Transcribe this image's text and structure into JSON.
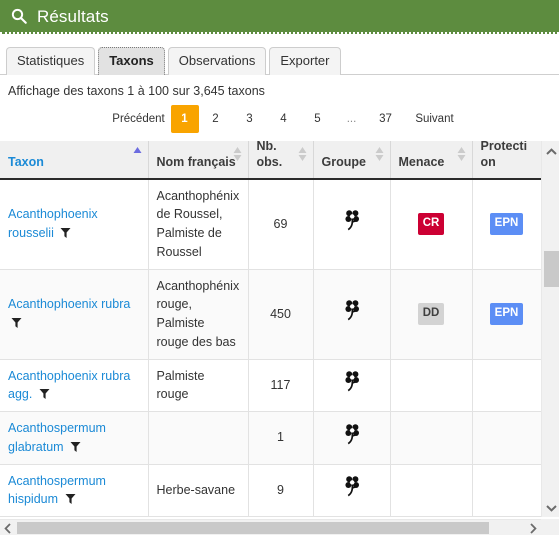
{
  "header": {
    "title": "Résultats",
    "icon": "search-icon",
    "bg_color": "#5d8c3f"
  },
  "tabs": [
    {
      "label": "Statistiques",
      "active": false
    },
    {
      "label": "Taxons",
      "active": true
    },
    {
      "label": "Observations",
      "active": false
    },
    {
      "label": "Exporter",
      "active": false
    }
  ],
  "results": {
    "summary": "Affichage des taxons 1 à 100 sur 3,645 taxons",
    "range_start": 1,
    "range_end": 100,
    "total": "3,645"
  },
  "pagination": {
    "previous_label": "Précédent",
    "next_label": "Suivant",
    "ellipsis": "...",
    "current_page": "1",
    "pages": [
      "1",
      "2",
      "3",
      "4",
      "5",
      "...",
      "37"
    ],
    "active_color": "#f9a400"
  },
  "table": {
    "columns": [
      {
        "label": "Taxon",
        "sorted": true,
        "sort_dir": "asc"
      },
      {
        "label": "Nom français",
        "sorted": false,
        "sort_dir": "none"
      },
      {
        "label": "Nb. obs.",
        "sorted": false,
        "sort_dir": "none"
      },
      {
        "label": "Groupe",
        "sorted": false,
        "sort_dir": "none"
      },
      {
        "label": "Menace",
        "sorted": false,
        "sort_dir": "none"
      },
      {
        "label": "Protection",
        "sorted": false,
        "sort_dir": "none"
      }
    ],
    "rows": [
      {
        "taxon": "Acanthophoenix rousselii",
        "filter_icon": "funnel-icon",
        "nom_francais": "Acanthophénix de Roussel, Palmiste de Roussel",
        "nb_obs": "69",
        "groupe": "flower-icon",
        "menace": "CR",
        "menace_style": "cr",
        "protection": "EPN",
        "protection_style": "epn"
      },
      {
        "taxon": "Acanthophoenix rubra",
        "filter_icon": "funnel-icon",
        "nom_francais": "Acanthophénix rouge, Palmiste rouge des bas",
        "nb_obs": "450",
        "groupe": "flower-icon",
        "menace": "DD",
        "menace_style": "dd",
        "protection": "EPN",
        "protection_style": "epn"
      },
      {
        "taxon": "Acanthophoenix rubra agg.",
        "filter_icon": "funnel-icon",
        "nom_francais": "Palmiste rouge",
        "nb_obs": "117",
        "groupe": "flower-icon",
        "menace": "",
        "menace_style": "",
        "protection": "",
        "protection_style": ""
      },
      {
        "taxon": "Acanthospermum glabratum",
        "filter_icon": "funnel-icon",
        "nom_francais": "",
        "nb_obs": "1",
        "groupe": "flower-icon",
        "menace": "",
        "menace_style": "",
        "protection": "",
        "protection_style": ""
      },
      {
        "taxon": "Acanthospermum hispidum",
        "filter_icon": "funnel-icon",
        "nom_francais": "Herbe-savane",
        "nb_obs": "9",
        "groupe": "flower-icon",
        "menace": "",
        "menace_style": "",
        "protection": "",
        "protection_style": ""
      }
    ]
  },
  "colors": {
    "link": "#1b8ad6",
    "menace_cr": "#cc0033",
    "menace_dd": "#d3d3d3",
    "protection_epn": "#5c8ef5",
    "sort_arrow_active": "#6c6ce0"
  }
}
